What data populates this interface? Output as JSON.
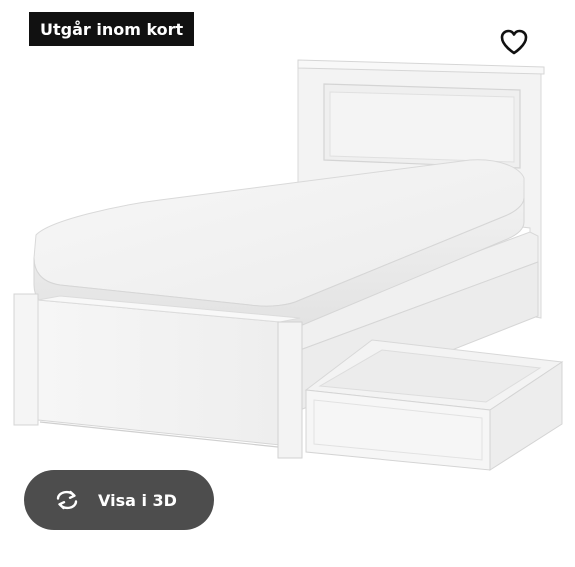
{
  "product": {
    "badge_text": "Utgår inom kort",
    "view_3d_label": "Visa i 3D",
    "image_subject": "bed-frame-with-storage-drawers",
    "favourite_icon": "heart-outline-icon",
    "view_3d_icon": "rotate-3d-icon"
  },
  "colors": {
    "badge_bg": "#111111",
    "badge_text": "#ffffff",
    "view_3d_bg": "#4d4d4d",
    "view_3d_text": "#ffffff",
    "icon": "#111111"
  }
}
